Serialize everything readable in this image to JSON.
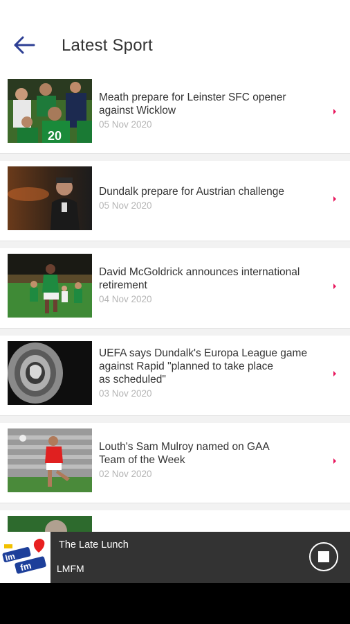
{
  "header": {
    "title": "Latest Sport",
    "back_icon": "arrow-left-icon",
    "accent": "#2d3f94"
  },
  "articles": [
    {
      "headline_lines": [
        "Meath prepare for Leinster SFC opener",
        "against Wicklow"
      ],
      "date": "05 Nov 2020",
      "image": "gaa-team-huddle-photo"
    },
    {
      "headline_lines": [
        "Dundalk prepare for Austrian challenge"
      ],
      "date": "05 Nov 2020",
      "image": "manager-portrait-photo"
    },
    {
      "headline_lines": [
        "David McGoldrick announces international",
        "retirement"
      ],
      "date": "04 Nov 2020",
      "image": "ireland-football-match-photo"
    },
    {
      "headline_lines": [
        "UEFA says Dundalk's Europa League game",
        "against Rapid \"planned to take place",
        "as scheduled\""
      ],
      "date": "03 Nov 2020",
      "image": "europa-league-trophy-photo"
    },
    {
      "headline_lines": [
        "Louth's Sam Mulroy named on GAA",
        "Team of the Week"
      ],
      "date": "02 Nov 2020",
      "image": "gaa-player-kicking-photo"
    }
  ],
  "chevron_color": "#e8175d",
  "player": {
    "show": "The Late Lunch",
    "station": "LMFM",
    "logo": "lmfm-logo",
    "stop_icon": "stop-icon"
  }
}
